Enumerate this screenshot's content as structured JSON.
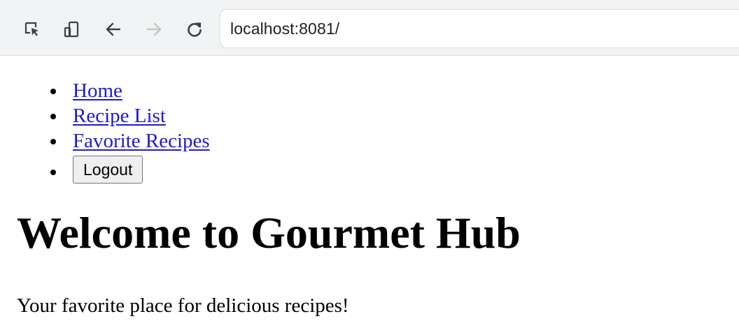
{
  "browser": {
    "url": "localhost:8081/",
    "toolbar_icons": [
      "inspect-cursor-icon",
      "device-toggle-icon",
      "back-arrow-icon",
      "forward-arrow-icon",
      "reload-icon"
    ]
  },
  "nav": {
    "items": [
      {
        "label": "Home"
      },
      {
        "label": "Recipe List"
      },
      {
        "label": "Favorite Recipes"
      }
    ],
    "logout_label": "Logout"
  },
  "main": {
    "title": "Welcome to Gourmet Hub",
    "tagline": "Your favorite place for delicious recipes!"
  },
  "colors": {
    "link": "#1d1ad6",
    "toolbar_bg": "#f1f3f4",
    "button_bg": "#efefef"
  }
}
